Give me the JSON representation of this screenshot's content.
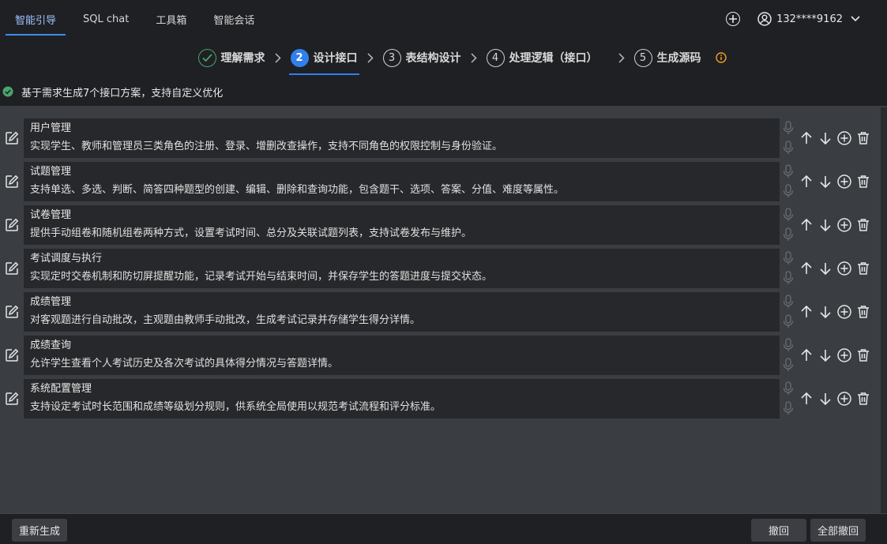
{
  "nav": {
    "tabs": [
      {
        "label": "智能引导",
        "active": true
      },
      {
        "label": "SQL chat",
        "active": false
      },
      {
        "label": "工具箱",
        "active": false
      },
      {
        "label": "智能会话",
        "active": false
      }
    ],
    "user": "132****9162"
  },
  "steps": [
    {
      "num": "✓",
      "label": "理解需求",
      "state": "done"
    },
    {
      "num": "2",
      "label": "设计接口",
      "state": "active"
    },
    {
      "num": "3",
      "label": "表结构设计",
      "state": "todo"
    },
    {
      "num": "4",
      "label": "处理逻辑（接口）",
      "state": "todo"
    },
    {
      "num": "5",
      "label": "生成源码",
      "state": "todo"
    }
  ],
  "status_text": "基于需求生成7个接口方案，支持自定义优化",
  "items": [
    {
      "title": "用户管理",
      "desc": "实现学生、教师和管理员三类角色的注册、登录、增删改查操作，支持不同角色的权限控制与身份验证。"
    },
    {
      "title": "试题管理",
      "desc": "支持单选、多选、判断、简答四种题型的创建、编辑、删除和查询功能，包含题干、选项、答案、分值、难度等属性。"
    },
    {
      "title": "试卷管理",
      "desc": "提供手动组卷和随机组卷两种方式，设置考试时间、总分及关联试题列表，支持试卷发布与维护。"
    },
    {
      "title": "考试调度与执行",
      "desc": "实现定时交卷机制和防切屏提醒功能，记录考试开始与结束时间，并保存学生的答题进度与提交状态。"
    },
    {
      "title": "成绩管理",
      "desc": "对客观题进行自动批改，主观题由教师手动批改，生成考试记录并存储学生得分详情。"
    },
    {
      "title": "成绩查询",
      "desc": "允许学生查看个人考试历史及各次考试的具体得分情况与答题详情。"
    },
    {
      "title": "系统配置管理",
      "desc": "支持设定考试时长范围和成绩等级划分规则，供系统全局使用以规范考试流程和评分标准。"
    }
  ],
  "buttons": {
    "regenerate": "重新生成",
    "undo": "撤回",
    "undo_all": "全部撤回"
  },
  "colors": {
    "accent": "#2f80ed",
    "success": "#4ca36d",
    "warning": "#f0a020"
  }
}
